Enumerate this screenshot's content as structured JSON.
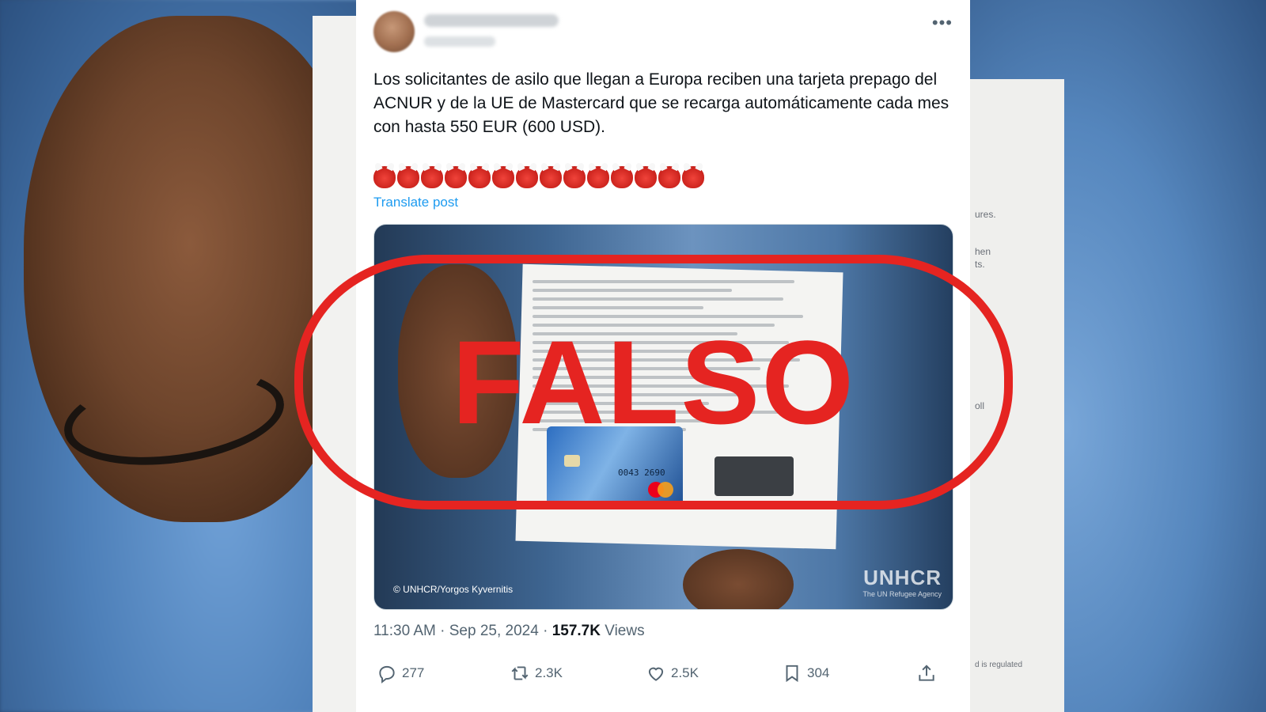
{
  "tweet": {
    "text": "Los solicitantes de asilo que llegan a Europa reciben una tarjeta prepago del ACNUR y de la UE de Mastercard que se recarga automáticamente cada mes con hasta 550 EUR (600 USD).",
    "emoji_icon": "ogre-face-icon",
    "emoji_count": 14,
    "translate_label": "Translate post",
    "more_icon": "more-horizontal-icon",
    "timestamp": "11:30 AM · Sep 25, 2024 · ",
    "views_count": "157.7K",
    "views_label": " Views",
    "media": {
      "credit": "© UNHCR/Yorgos Kyvernitis",
      "logo": "UNHCR",
      "logo_sub": "The UN Refugee Agency",
      "card_number": "0043 2690"
    },
    "actions": [
      {
        "icon": "reply-icon",
        "count": "277"
      },
      {
        "icon": "retweet-icon",
        "count": "2.3K"
      },
      {
        "icon": "like-icon",
        "count": "2.5K"
      },
      {
        "icon": "bookmark-icon",
        "count": "304"
      },
      {
        "icon": "share-icon",
        "count": ""
      }
    ]
  },
  "stamp": {
    "label": "FALSO",
    "color": "#e52421"
  },
  "colors": {
    "link": "#1d9bf0",
    "text": "#0f1419",
    "muted": "#536471"
  },
  "background_text": [
    "ures.",
    "hen",
    "ts.",
    "oll",
    "d is regulated"
  ]
}
